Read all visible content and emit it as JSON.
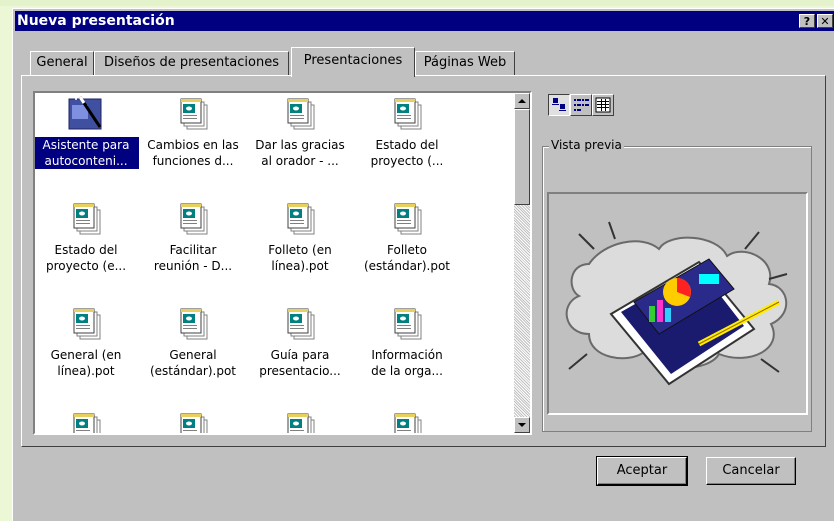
{
  "dialog": {
    "title": "Nueva presentación",
    "help_label": "?",
    "close_label": "✕"
  },
  "tabs": [
    {
      "label": "General"
    },
    {
      "label": "Diseños de presentaciones"
    },
    {
      "label": "Presentaciones",
      "active": true
    },
    {
      "label": "Páginas Web"
    }
  ],
  "items": [
    {
      "line1": "Asistente para",
      "line2": "autoconteni...",
      "icon": "wizard-icon",
      "selected": true
    },
    {
      "line1": "Cambios en las",
      "line2": "funciones d...",
      "icon": "presentation-file-icon"
    },
    {
      "line1": "Dar las gracias",
      "line2": "al orador - ...",
      "icon": "presentation-file-icon"
    },
    {
      "line1": "Estado del",
      "line2": "proyecto (...",
      "icon": "presentation-file-icon"
    },
    {
      "line1": "Estado del",
      "line2": "proyecto (e...",
      "icon": "presentation-file-icon"
    },
    {
      "line1": "Facilitar",
      "line2": "reunión - D...",
      "icon": "presentation-file-icon"
    },
    {
      "line1": "Folleto (en",
      "line2": "línea).pot",
      "icon": "presentation-file-icon"
    },
    {
      "line1": "Folleto",
      "line2": "(estándar).pot",
      "icon": "presentation-file-icon"
    },
    {
      "line1": "General (en",
      "line2": "línea).pot",
      "icon": "presentation-file-icon"
    },
    {
      "line1": "General",
      "line2": "(estándar).pot",
      "icon": "presentation-file-icon"
    },
    {
      "line1": "Guía para",
      "line2": "presentacio...",
      "icon": "presentation-file-icon"
    },
    {
      "line1": "Información",
      "line2": "de la orga...",
      "icon": "presentation-file-icon"
    },
    {
      "line1": "",
      "line2": "",
      "icon": "presentation-file-icon"
    },
    {
      "line1": "",
      "line2": "",
      "icon": "presentation-file-icon"
    },
    {
      "line1": "",
      "line2": "",
      "icon": "presentation-file-icon"
    },
    {
      "line1": "",
      "line2": "",
      "icon": "presentation-file-icon"
    }
  ],
  "view_buttons": [
    {
      "icon": "large-icons-view-icon",
      "pressed": true
    },
    {
      "icon": "list-view-icon"
    },
    {
      "icon": "details-view-icon"
    }
  ],
  "preview": {
    "label": "Vista previa",
    "image": "presentation-clipart-icon"
  },
  "buttons": {
    "ok": "Aceptar",
    "cancel": "Cancelar"
  }
}
